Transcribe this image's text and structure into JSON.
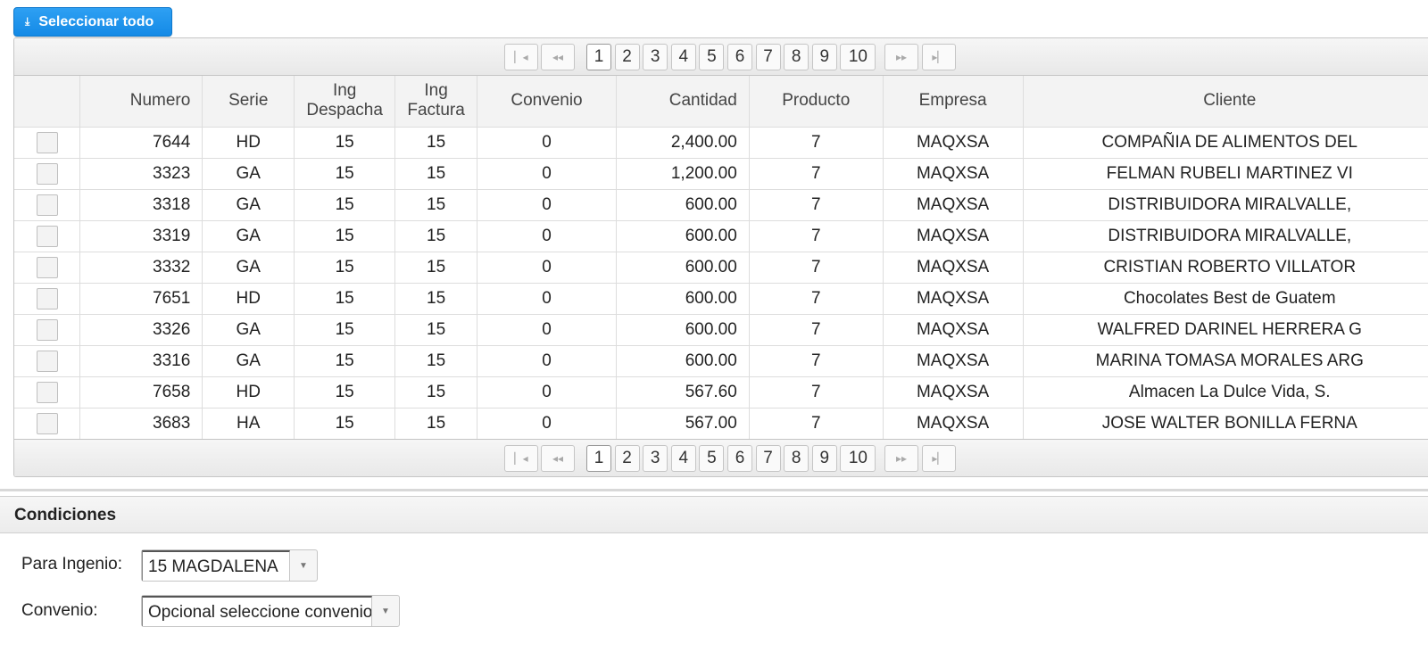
{
  "toolbar": {
    "select_all_label": "Seleccionar todo"
  },
  "pager": {
    "pages": [
      "1",
      "2",
      "3",
      "4",
      "5",
      "6",
      "7",
      "8",
      "9",
      "10"
    ],
    "current": "1",
    "first_icon": "first-page-icon",
    "prev_icon": "prev-page-icon",
    "next_icon": "next-page-icon",
    "last_icon": "last-page-icon"
  },
  "grid": {
    "columns": [
      "",
      "Numero",
      "Serie",
      "Ing\nDespacha",
      "Ing\nFactura",
      "Convenio",
      "Cantidad",
      "Producto",
      "Empresa",
      "Cliente"
    ],
    "rows": [
      [
        "7644",
        "HD",
        "15",
        "15",
        "0",
        "2,400.00",
        "7",
        "MAQXSA",
        "COMPAÑIA DE ALIMENTOS DEL"
      ],
      [
        "3323",
        "GA",
        "15",
        "15",
        "0",
        "1,200.00",
        "7",
        "MAQXSA",
        "FELMAN RUBELI MARTINEZ VI"
      ],
      [
        "3318",
        "GA",
        "15",
        "15",
        "0",
        "600.00",
        "7",
        "MAQXSA",
        "DISTRIBUIDORA MIRALVALLE,"
      ],
      [
        "3319",
        "GA",
        "15",
        "15",
        "0",
        "600.00",
        "7",
        "MAQXSA",
        "DISTRIBUIDORA MIRALVALLE,"
      ],
      [
        "3332",
        "GA",
        "15",
        "15",
        "0",
        "600.00",
        "7",
        "MAQXSA",
        "CRISTIAN ROBERTO VILLATOR"
      ],
      [
        "7651",
        "HD",
        "15",
        "15",
        "0",
        "600.00",
        "7",
        "MAQXSA",
        "Chocolates Best de Guatem"
      ],
      [
        "3326",
        "GA",
        "15",
        "15",
        "0",
        "600.00",
        "7",
        "MAQXSA",
        "WALFRED DARINEL HERRERA G"
      ],
      [
        "3316",
        "GA",
        "15",
        "15",
        "0",
        "600.00",
        "7",
        "MAQXSA",
        "MARINA TOMASA MORALES ARG"
      ],
      [
        "7658",
        "HD",
        "15",
        "15",
        "0",
        "567.60",
        "7",
        "MAQXSA",
        "Almacen La Dulce Vida, S."
      ],
      [
        "3683",
        "HA",
        "15",
        "15",
        "0",
        "567.00",
        "7",
        "MAQXSA",
        "JOSE WALTER BONILLA FERNA"
      ]
    ]
  },
  "conditions": {
    "title": "Condiciones",
    "ingenio_label": "Para Ingenio:",
    "ingenio_value": "15 MAGDALENA",
    "convenio_label": "Convenio:",
    "convenio_value": "Opcional seleccione convenio"
  }
}
